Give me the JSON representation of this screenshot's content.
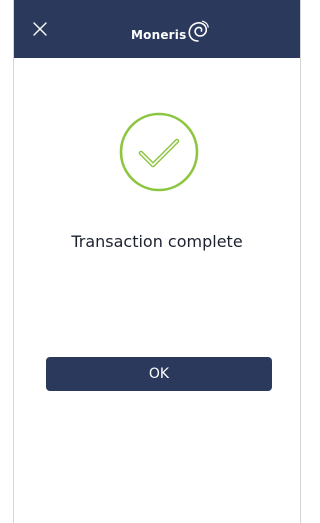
{
  "header": {
    "close_icon": "close-icon",
    "brand_name": "Moneris",
    "brand_icon": "moneris-swirl-logo"
  },
  "main": {
    "status_icon": "checkmark-circle-icon",
    "message": "Transaction complete",
    "ok_label": "OK"
  },
  "colors": {
    "header_background": "#2b3a5c",
    "button_background": "#2b3a5c",
    "success_accent": "#8cc63f",
    "text_primary": "#1d2230"
  }
}
